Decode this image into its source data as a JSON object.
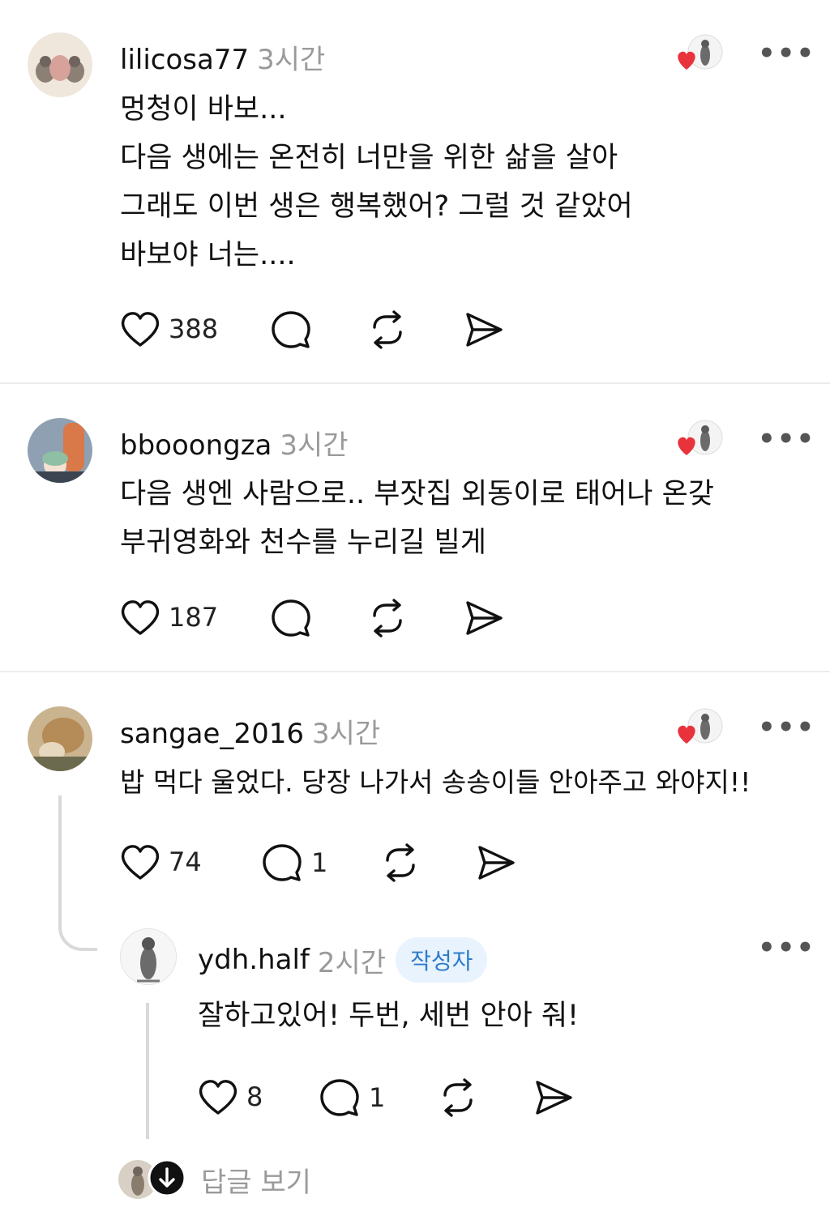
{
  "comments": [
    {
      "username": "lilicosa77",
      "time": "3시간",
      "lines": [
        "멍청이 바보...",
        "다음 생에는 온전히 너만을 위한 삶을 살아",
        "그래도 이번 생은 행복했어? 그럴 것 같았어",
        "바보야 너는...."
      ],
      "likes": "388",
      "replies": ""
    },
    {
      "username": "bbooongza",
      "time": "3시간",
      "lines": [
        "다음 생엔 사람으로.. 부잣집 외동이로 태어나 온갖",
        "부귀영화와 천수를 누리길 빌게"
      ],
      "likes": "187",
      "replies": ""
    },
    {
      "username": "sangae_2016",
      "time": "3시간",
      "lines": [
        "밥 먹다 울었다. 당장 나가서 송송이들 안아주고 와야지!!"
      ],
      "likes": "74",
      "replies": "1"
    }
  ],
  "reply": {
    "username": "ydh.half",
    "time": "2시간",
    "badge": "작성자",
    "text": "잘하고있어! 두번, 세번 안아 줘!",
    "likes": "8",
    "replies": "1"
  },
  "more_label": "•••",
  "view_replies_label": "답글 보기",
  "colors": {
    "heart": "#e8323c",
    "badge_bg": "#e8f3fd",
    "badge_text": "#2e7cc9"
  },
  "icons": [
    "like-heart-icon",
    "comment-icon",
    "repost-icon",
    "share-icon",
    "more-icon",
    "author-liked-heart-icon",
    "expand-down-icon"
  ]
}
